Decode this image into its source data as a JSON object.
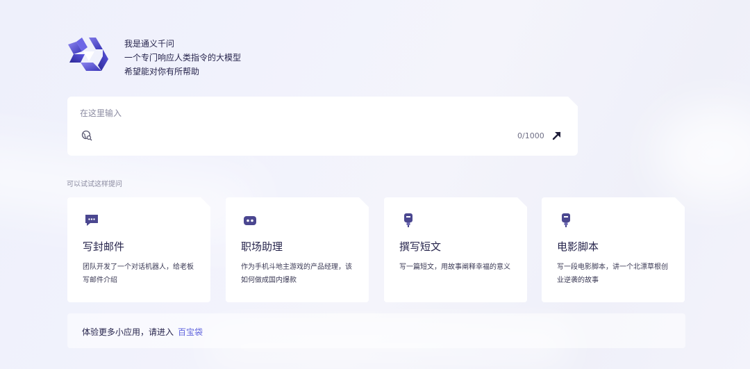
{
  "intro": {
    "line1": "我是通义千问",
    "line2": "一个专门响应人类指令的大模型",
    "line3": "希望能对你有所帮助"
  },
  "input": {
    "placeholder": "在这里输入",
    "char_count": "0/1000"
  },
  "suggest_label": "可以试试这样提问",
  "cards": [
    {
      "icon": "chat-bubble-icon",
      "title": "写封邮件",
      "desc": "团队开发了一个对话机器人，给老板写邮件介绍"
    },
    {
      "icon": "robot-icon",
      "title": "职场助理",
      "desc": "作为手机斗地主游戏的产品经理，该如何做成国内爆款"
    },
    {
      "icon": "pen-icon",
      "title": "撰写短文",
      "desc": "写一篇短文，用故事阐释幸福的意义"
    },
    {
      "icon": "pen-icon",
      "title": "电影脚本",
      "desc": "写一段电影脚本，讲一个北漂草根创业逆袭的故事"
    }
  ],
  "bottom": {
    "text": "体验更多小应用，请进入",
    "link": "百宝袋"
  },
  "colors": {
    "accent": "#6064dd",
    "text": "#26244c",
    "logo_dark": "#3a36b8",
    "logo_light": "#8d86f0"
  }
}
